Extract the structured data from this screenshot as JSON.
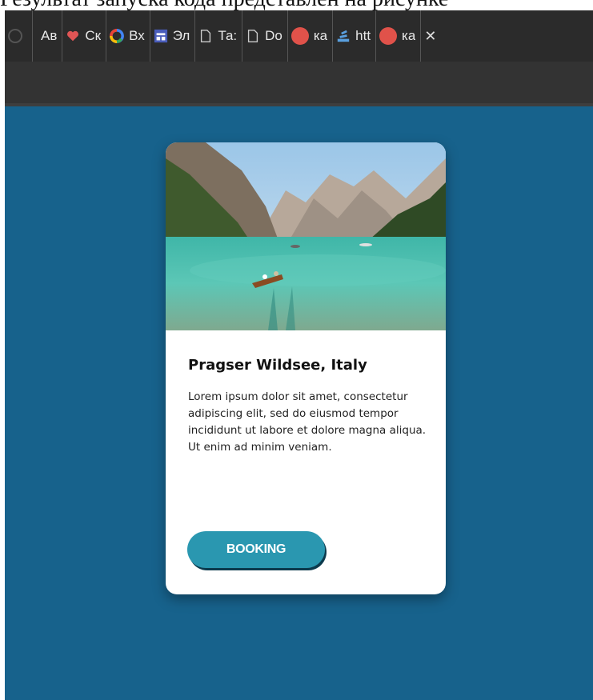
{
  "caption": {
    "text": "Результат запуска кода представлен на рисунке"
  },
  "bookmarks": [
    {
      "icon": "history-icon",
      "label": "",
      "color": "#555555"
    },
    {
      "icon": "bookmark-icon",
      "label": "Ав",
      "color": "#888888"
    },
    {
      "icon": "heart-icon",
      "label": "Ск",
      "color": "#e05555"
    },
    {
      "icon": "google-icon",
      "label": "Вх",
      "color": "#4285f4"
    },
    {
      "icon": "window-icon",
      "label": "Эл",
      "color": "#4a5dbb"
    },
    {
      "icon": "page-icon",
      "label": "Та:",
      "color": "#cccccc"
    },
    {
      "icon": "page-icon",
      "label": "Do",
      "color": "#cccccc"
    },
    {
      "icon": "yandex-icon",
      "label": "ка",
      "color": "#e0524a"
    },
    {
      "icon": "stack-icon",
      "label": "htt",
      "color": "#5aa0e0"
    },
    {
      "icon": "yandex-icon",
      "label": "ка",
      "color": "#e0524a"
    },
    {
      "icon": "close-icon",
      "label": "",
      "color": "#dddddd"
    }
  ],
  "card": {
    "image_alt": "mountain-lake-photo",
    "title": "Pragser Wildsee, Italy",
    "text": "Lorem ipsum dolor sit amet, consectetur adipiscing elit, sed do eiusmod tempor incididunt ut labore et dolore magna aliqua. Ut enim ad minim veniam.",
    "button_label": "BOOKING"
  },
  "colors": {
    "page_background": "#17628c",
    "button": "#2a97b0",
    "button_shadow": "#0b3a4d"
  }
}
